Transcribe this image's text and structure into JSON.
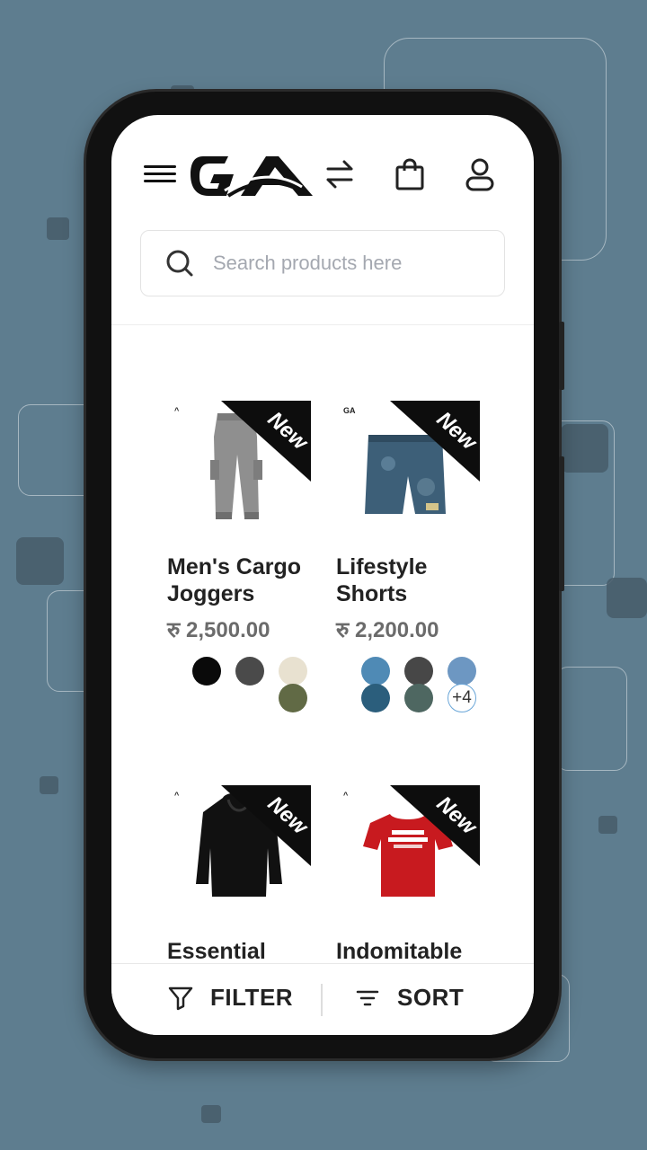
{
  "theme": {
    "background": "#5e7d8f",
    "accent": "#0d0d0d",
    "price_color": "#6b6b6b"
  },
  "header": {
    "menu_icon": "hamburger-menu-icon",
    "logo_text": "GA",
    "compare_icon": "swap-arrows-icon",
    "cart_icon": "shopping-bag-icon",
    "account_icon": "user-icon"
  },
  "search": {
    "placeholder": "Search products here",
    "value": "",
    "icon": "search-icon"
  },
  "products": [
    {
      "name": "Men's Cargo Joggers",
      "price": "रु 2,500.00",
      "badge": "New",
      "image": "grey-cargo-joggers",
      "colors": [
        "#0a0a0a",
        "#4a4a4a",
        "#e8e1d0",
        "#616a45"
      ]
    },
    {
      "name": "Lifestyle Shorts",
      "price": "रु 2,200.00",
      "badge": "New",
      "image": "blue-shorts",
      "colors": [
        "#4f8ab5",
        "#474747",
        "#6d97c2",
        "#2b5e7c",
        "#4e6761"
      ],
      "more_colors": "+4"
    },
    {
      "name": "Essential Hoodie",
      "badge": "New",
      "image": "black-hoodie"
    },
    {
      "name": "Indomitable Spirit",
      "badge": "New",
      "image": "red-tshirt"
    }
  ],
  "bottom_bar": {
    "filter_label": "FILTER",
    "filter_icon": "filter-funnel-icon",
    "sort_label": "SORT",
    "sort_icon": "sort-lines-icon"
  }
}
